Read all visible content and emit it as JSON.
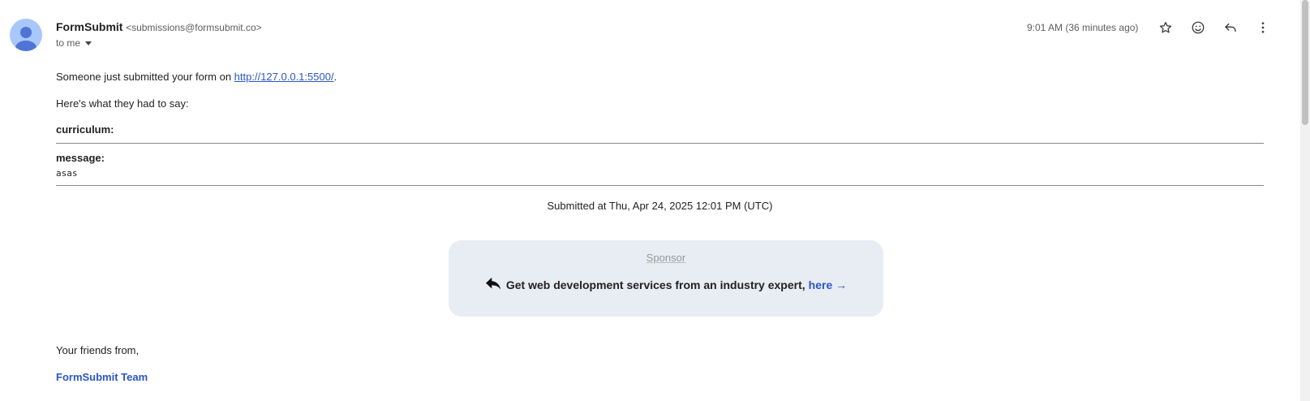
{
  "sender": {
    "name": "FormSubmit",
    "email": "<submissions@formsubmit.co>",
    "recipient_label": "to me"
  },
  "header": {
    "timestamp": "9:01 AM (36 minutes ago)",
    "icons": [
      "star-icon",
      "emoji-icon",
      "reply-icon",
      "more-vert-icon"
    ]
  },
  "message": {
    "intro_prefix": "Someone just submitted your form on ",
    "intro_link": "http://127.0.0.1:5500/",
    "intro_suffix": ".",
    "lead": "Here's what they had to say:",
    "fields": [
      {
        "label": "curriculum:",
        "value": ""
      },
      {
        "label": "message:",
        "value": "asas"
      }
    ],
    "submitted": "Submitted at Thu, Apr 24, 2025 12:01 PM (UTC)"
  },
  "sponsor": {
    "label": "Sponsor",
    "text": "Get web development services from an industry expert,",
    "link": "here →"
  },
  "footer": {
    "closing": "Your friends from,",
    "team": "FormSubmit Team"
  },
  "colors": {
    "link": "#2a56c6",
    "avatar_bg": "#a8c7fa",
    "avatar_fg": "#4e75d6",
    "sponsor_bg": "#e8ecf3"
  }
}
